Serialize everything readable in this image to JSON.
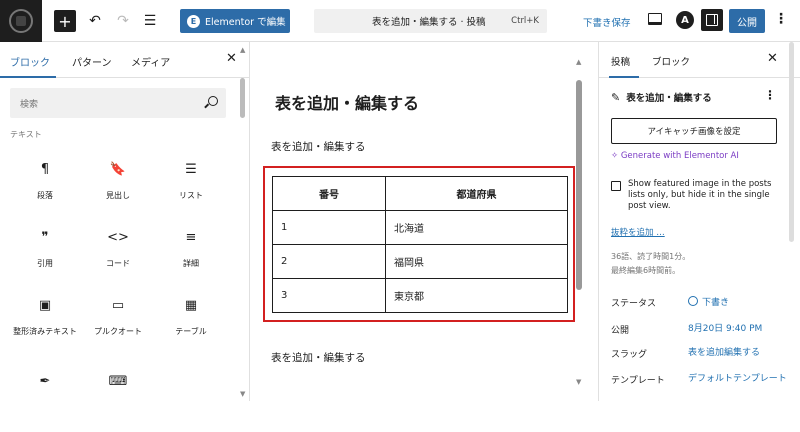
{
  "toolbar": {
    "elementor_label": "Elementor で編集",
    "command_title": "表を追加・編集する · 投稿",
    "command_shortcut": "Ctrl+K",
    "save_draft_label": "下書き保存",
    "publish_label": "公開",
    "astra_label": "A"
  },
  "left_panel": {
    "tabs": [
      "ブロック",
      "パターン",
      "メディア"
    ],
    "search_placeholder": "検索",
    "category": "テキスト",
    "blocks": [
      {
        "icon": "¶",
        "label": "段落"
      },
      {
        "icon": "🔖",
        "label": "見出し"
      },
      {
        "icon": "☰",
        "label": "リスト"
      },
      {
        "icon": "❞",
        "label": "引用"
      },
      {
        "icon": "<>",
        "label": "コード"
      },
      {
        "icon": "≡",
        "label": "詳細"
      },
      {
        "icon": "▣",
        "label": "整形済みテキスト"
      },
      {
        "icon": "▭",
        "label": "プルクオート"
      },
      {
        "icon": "▦",
        "label": "テーブル"
      },
      {
        "icon": "✒",
        "label": ""
      },
      {
        "icon": "⌨",
        "label": ""
      }
    ]
  },
  "editor": {
    "title": "表を追加・編集する",
    "paragraph_1": "表を追加・編集する",
    "paragraph_2": "表を追加・編集する",
    "table": {
      "headers": [
        "番号",
        "都道府県"
      ],
      "rows": [
        [
          "1",
          "北海道"
        ],
        [
          "2",
          "福岡県"
        ],
        [
          "3",
          "東京都"
        ]
      ]
    },
    "highlight_color": "#d32020"
  },
  "right_panel": {
    "tabs": [
      "投稿",
      "ブロック"
    ],
    "post_title": "表を追加・編集する",
    "featured_image_button": "アイキャッチ画像を設定",
    "generate_link": "✧ Generate with Elementor AI",
    "featured_checkbox_label": "Show featured image in the posts lists only, but hide it in the single post view.",
    "excerpt_link": "抜粋を追加 …",
    "stats_line1": "36語、読了時間1分。",
    "stats_line2": "最終編集6時間前。",
    "rows": [
      {
        "key": "ステータス",
        "value": "下書き"
      },
      {
        "key": "公開",
        "value": "8月20日 9:40 PM"
      },
      {
        "key": "スラッグ",
        "value": "表を追加編集する"
      },
      {
        "key": "テンプレート",
        "value": "デフォルトテンプレート"
      }
    ]
  },
  "colors": {
    "accent": "#2d6ca8",
    "link": "#2271b1",
    "ai": "#7b3cc4"
  }
}
